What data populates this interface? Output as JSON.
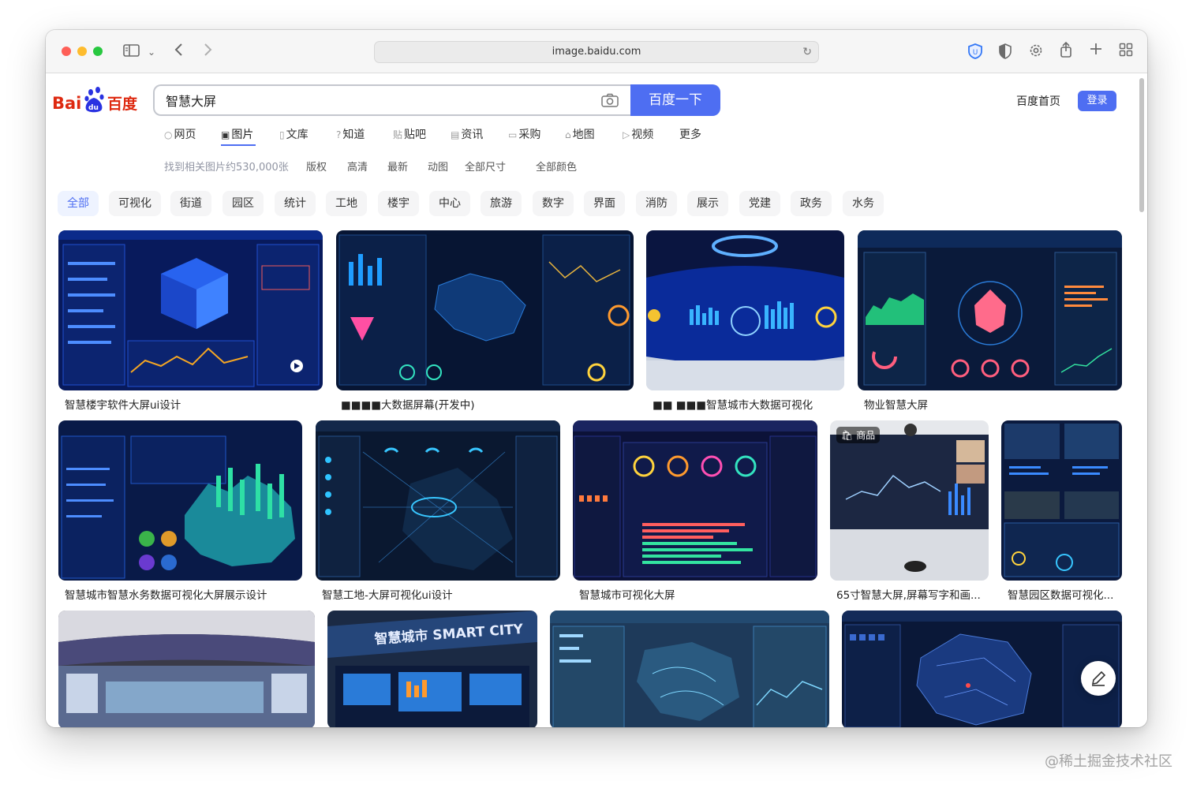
{
  "browser": {
    "url": "image.baidu.com"
  },
  "header": {
    "logo_text": "Bai百度",
    "search_value": "智慧大屏",
    "search_button": "百度一下",
    "home_link": "百度首页",
    "login_button": "登录",
    "brand_color": "#4e6ef2"
  },
  "nav": {
    "items": [
      {
        "label": "网页",
        "icon": "search-icon"
      },
      {
        "label": "图片",
        "icon": "image-icon"
      },
      {
        "label": "文库",
        "icon": "doc-icon"
      },
      {
        "label": "知道",
        "icon": "question-icon"
      },
      {
        "label": "贴吧",
        "icon": "tieba-icon"
      },
      {
        "label": "资讯",
        "icon": "news-icon"
      },
      {
        "label": "采购",
        "icon": "cart-icon"
      },
      {
        "label": "地图",
        "icon": "map-icon"
      },
      {
        "label": "视频",
        "icon": "video-icon"
      },
      {
        "label": "更多",
        "icon": ""
      }
    ],
    "active": "图片"
  },
  "filters": {
    "count_text": "找到相关图片约530,000张",
    "options": [
      "版权",
      "高清",
      "最新",
      "动图",
      "全部尺寸",
      "全部颜色"
    ]
  },
  "categories": [
    "全部",
    "可视化",
    "街道",
    "园区",
    "统计",
    "工地",
    "楼宇",
    "中心",
    "旅游",
    "数字",
    "界面",
    "消防",
    "展示",
    "党建",
    "政务",
    "水务"
  ],
  "results": {
    "row1": [
      {
        "caption": "智慧楼宇软件大屏ui设计"
      },
      {
        "caption": "■■■■大数据屏幕(开发中)"
      },
      {
        "caption": "■■ ■■■智慧城市大数据可视化"
      },
      {
        "caption": "物业智慧大屏"
      }
    ],
    "row2": [
      {
        "caption": "智慧城市智慧水务数据可视化大屏展示设计"
      },
      {
        "caption": "智慧工地-大屏可视化ui设计"
      },
      {
        "caption": "智慧城市可视化大屏"
      },
      {
        "caption": "65寸智慧大屏,屏幕写字和画...",
        "badge": "商品"
      },
      {
        "caption": "智慧园区数据可视化..."
      }
    ],
    "row3": [
      {
        "caption": ""
      },
      {
        "caption": ""
      },
      {
        "caption": ""
      },
      {
        "caption": ""
      }
    ]
  },
  "watermark": "@稀土掘金技术社区"
}
